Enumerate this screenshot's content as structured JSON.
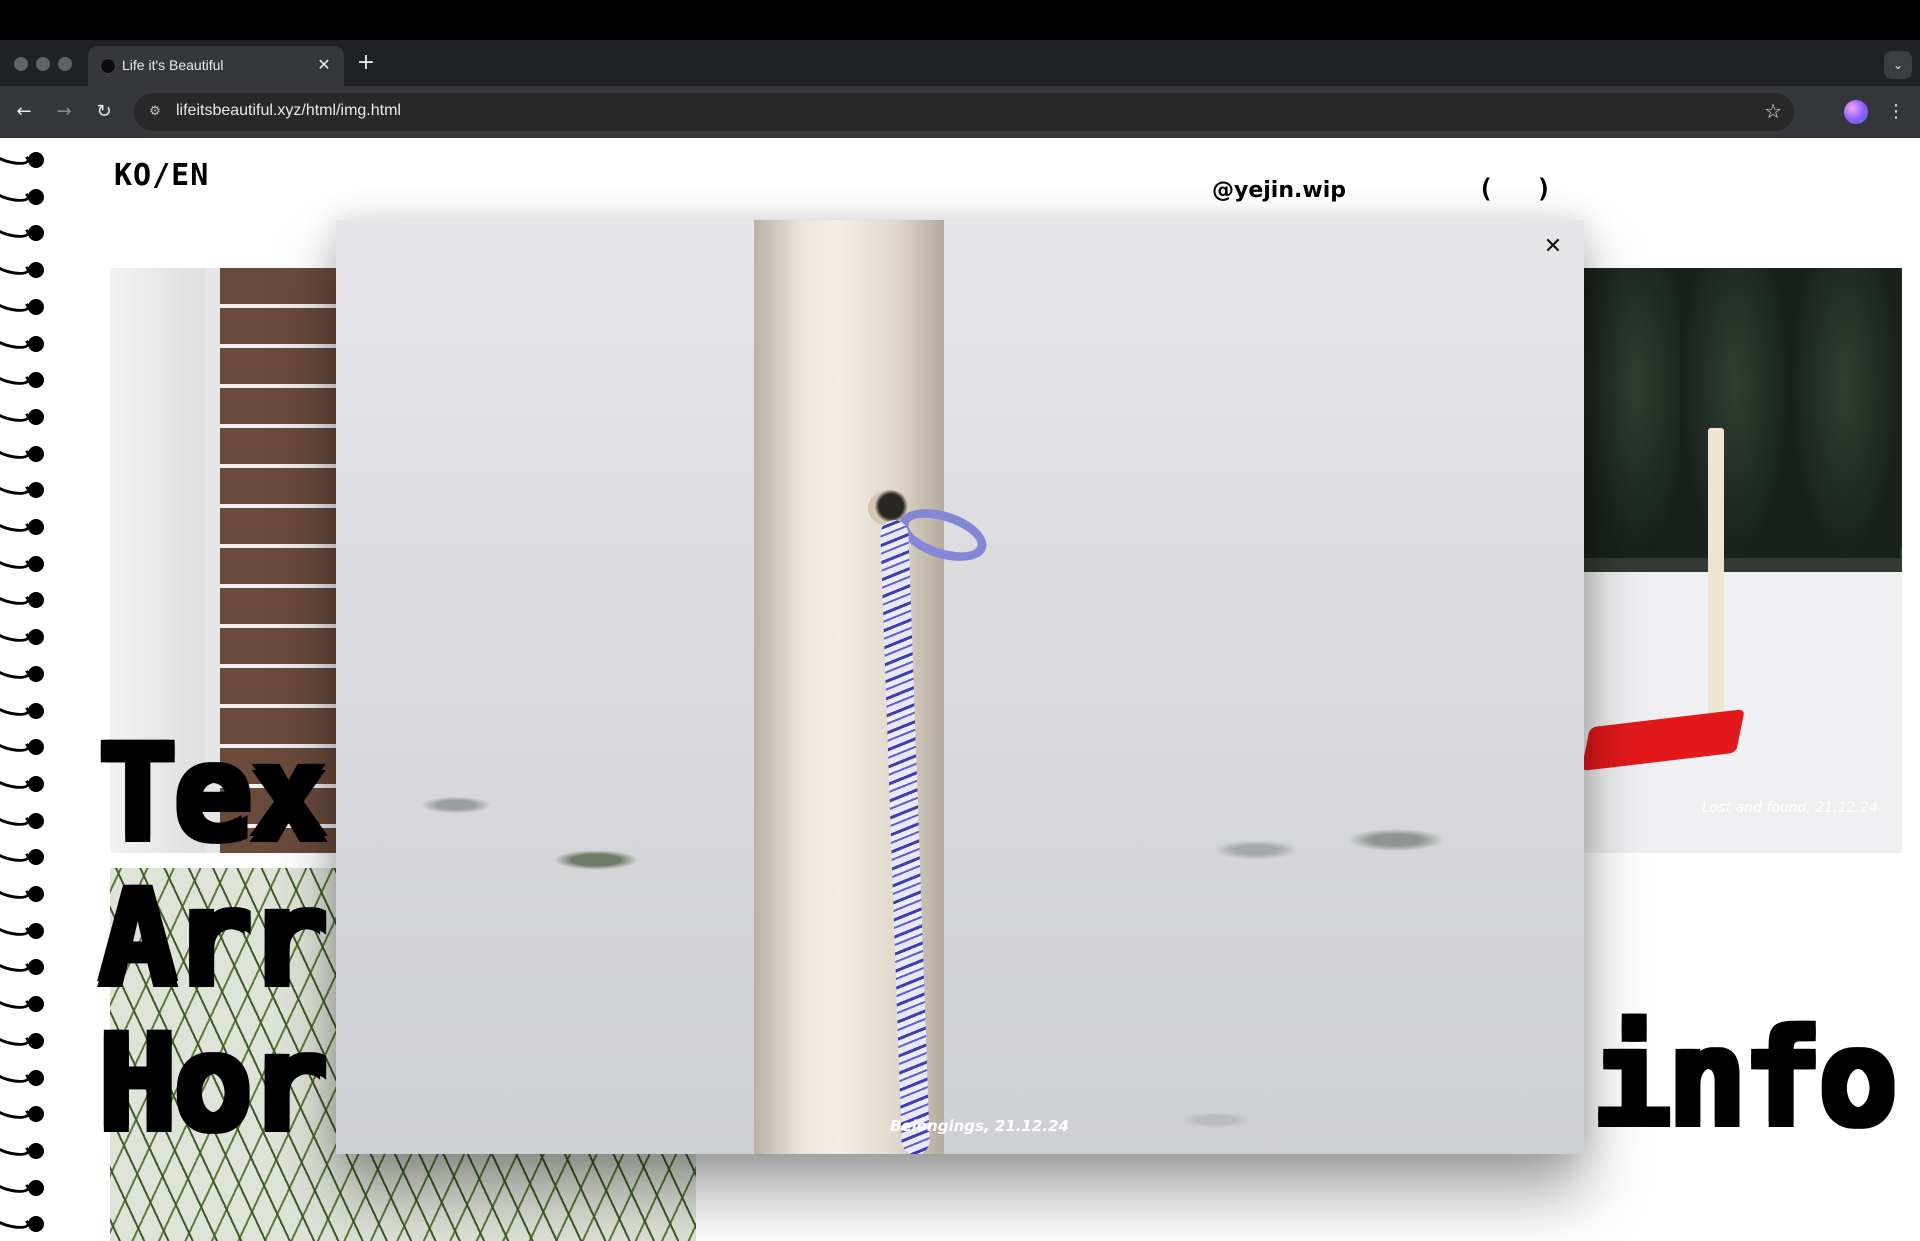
{
  "browser": {
    "tab_title": "Life it's Beautiful",
    "tab_close": "✕",
    "new_tab": "+",
    "tab_menu": "⌄",
    "back": "←",
    "forward": "→",
    "reload": "↻",
    "site_info": "⚙",
    "url": "lifeitsbeautiful.xyz/html/img.html",
    "bookmark": "☆",
    "menu": "⋮"
  },
  "header": {
    "lang_switch": "KO/EN",
    "instagram_handle": "@yejin.wip",
    "bracket_open": "(",
    "bracket_close": ")"
  },
  "display_words": {
    "word_1": "Tex",
    "word_2": "Arr",
    "word_3": "Hor",
    "word_4": "info"
  },
  "gallery": {
    "sled_caption": "Lost and found, 21.12.24"
  },
  "lightbox": {
    "close": "✕",
    "caption": "Belongings, 21.12.24"
  }
}
